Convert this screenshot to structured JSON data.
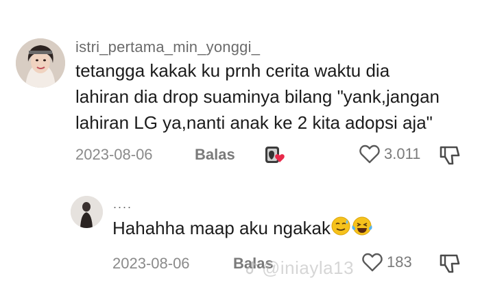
{
  "comments": [
    {
      "username": "istri_pertama_min_yonggi_",
      "lines": [
        "tetangga kakak ku prnh cerita waktu dia",
        "lahiran dia drop suaminya bilang \"yank,jangan",
        "lahiran LG ya,nanti anak ke 2 kita adopsi aja\""
      ],
      "date": "2023-08-06",
      "reply_label": "Balas",
      "likes": "3.011"
    },
    {
      "username": "....",
      "text": "Hahahha maap aku ngakak",
      "date": "2023-08-06",
      "reply_label": "Balas",
      "likes": "183"
    }
  ],
  "watermark": "@iniayla13",
  "colors": {
    "text": "#1c1c1c",
    "muted": "#8a8a8a",
    "heart_badge": "#e8294a"
  },
  "icons": [
    "heart-outline-icon",
    "dislike-icon",
    "creator-liked-icon",
    "sweat-smile-emoji",
    "laugh-cry-emoji",
    "tiktok-icon"
  ]
}
